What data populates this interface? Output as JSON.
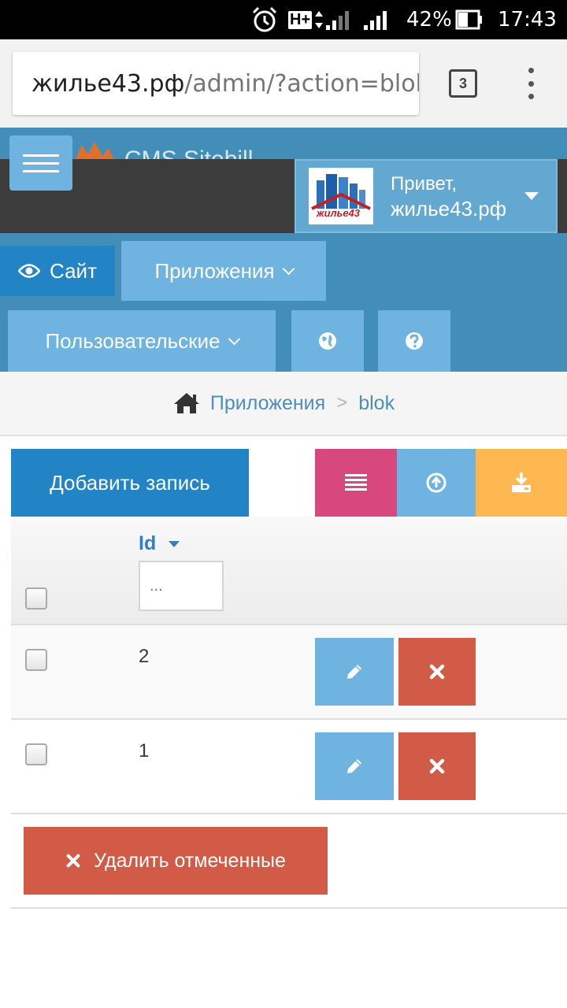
{
  "status_bar": {
    "network": "H+",
    "battery": "42%",
    "time": "17:43"
  },
  "browser": {
    "url_host": "жилье43.рф",
    "url_path": "/admin/?action=blok",
    "tab_count": "3"
  },
  "header": {
    "brand_text": "CMS Sitebill",
    "greeting": "Привет,",
    "username": "жилье43.рф",
    "avatar_label": "жилье43"
  },
  "nav": {
    "site_label": "Сайт",
    "apps_label": "Приложения",
    "custom_label": "Пользовательские"
  },
  "breadcrumb": {
    "parent": "Приложения",
    "current": "blok"
  },
  "toolbar": {
    "add_label": "Добавить запись"
  },
  "table": {
    "id_header": "Id",
    "filter_placeholder": "...",
    "rows": [
      {
        "id": "2"
      },
      {
        "id": "1"
      }
    ]
  },
  "actions": {
    "delete_selected_label": "Удалить отмеченные"
  },
  "colors": {
    "primary": "#2283c5",
    "light_blue": "#6fb3e0",
    "pink": "#d6487e",
    "orange": "#ffb752",
    "danger": "#d15b47",
    "navbar": "#438eb9"
  }
}
